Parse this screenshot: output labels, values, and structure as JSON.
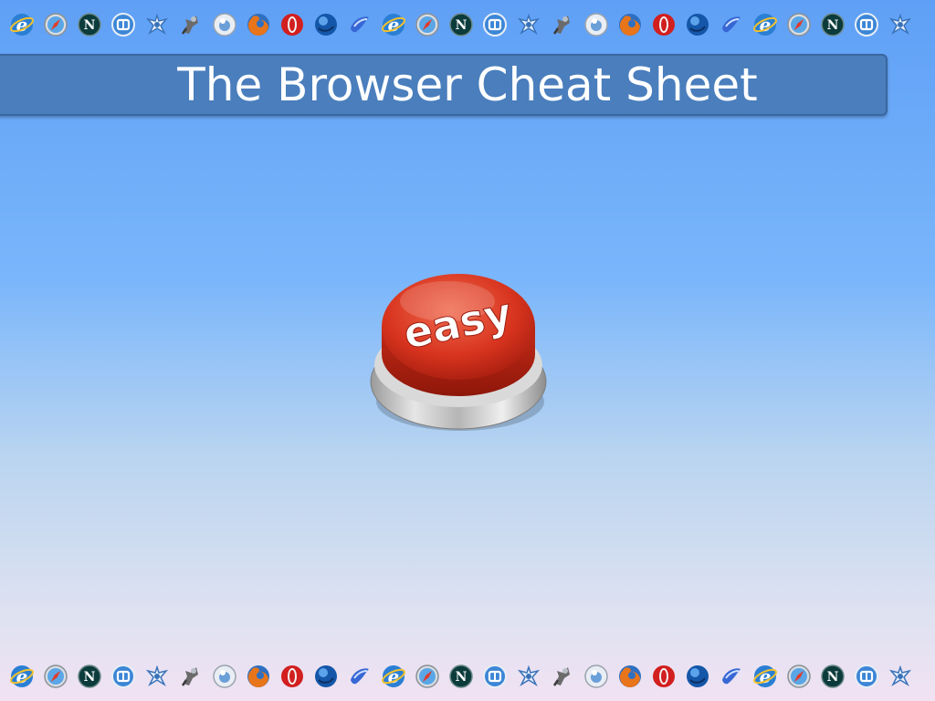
{
  "slide": {
    "title": "The Browser Cheat Sheet",
    "button_label": "easy"
  },
  "icon_strip": {
    "sequence": [
      "ie",
      "safari",
      "netscape",
      "maxthon",
      "galeon",
      "epiphany",
      "konqueror",
      "firefox",
      "opera",
      "seamonkey",
      "flock"
    ],
    "repeat_count": 27
  },
  "colors": {
    "background_top": "#5fa0f6",
    "background_bottom": "#f1e2f3",
    "title_bar": "#4a7ebd",
    "title_text": "#ffffff",
    "button_red": "#d8341f"
  }
}
